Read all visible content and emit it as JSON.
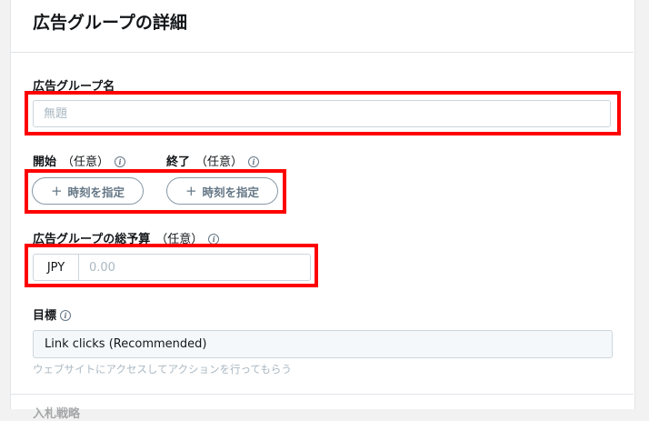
{
  "page": {
    "title": "広告グループの詳細"
  },
  "name_field": {
    "label": "広告グループ名",
    "placeholder": "無題"
  },
  "schedule": {
    "start_label": "開始",
    "end_label": "終了",
    "optional": "（任意）",
    "start_button": "時刻を指定",
    "end_button": "時刻を指定",
    "plus": "+"
  },
  "budget": {
    "label": "広告グループの総予算",
    "optional": "（任意）",
    "currency": "JPY",
    "placeholder": "0.00"
  },
  "objective": {
    "label": "目標",
    "value": "Link clicks (Recommended)",
    "helper": "ウェブサイトにアクセスしてアクションを行ってもらう"
  },
  "next_section": {
    "label": "入札戦略"
  },
  "icons": {
    "info": "info-icon"
  },
  "colors": {
    "highlight": "#ff0000",
    "text": "#14171a",
    "muted": "#657786",
    "placeholder": "#aab8c2"
  }
}
